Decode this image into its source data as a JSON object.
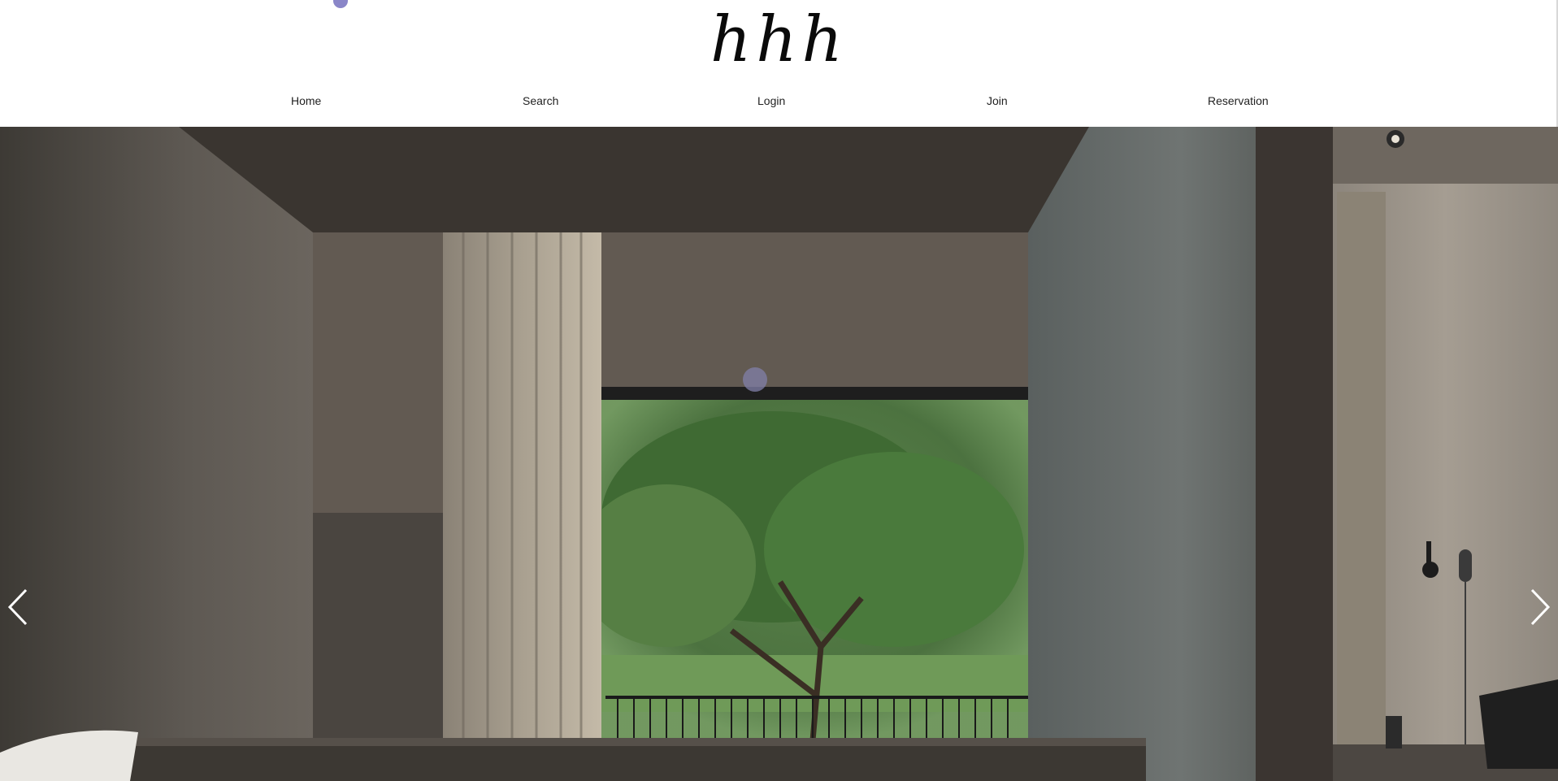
{
  "brand": {
    "logo": "hhh"
  },
  "nav": {
    "items": [
      {
        "label": "Home"
      },
      {
        "label": "Search"
      },
      {
        "label": "Login"
      },
      {
        "label": "Join"
      },
      {
        "label": "Reservation"
      }
    ]
  },
  "hero": {
    "image": "hotel-room-window-tree-photo",
    "prev_icon": "chevron-left-icon",
    "next_icon": "chevron-right-icon"
  },
  "colors": {
    "header_bg": "#ffffff",
    "text": "#222222",
    "accent_dot": "#8a86c8"
  }
}
